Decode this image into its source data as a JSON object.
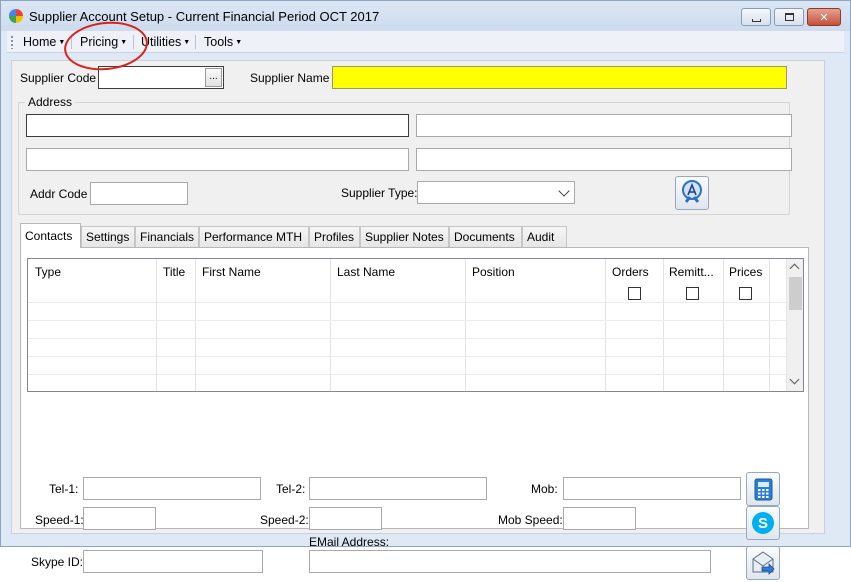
{
  "window": {
    "title": "Supplier Account Setup - Current Financial Period OCT 2017"
  },
  "menubar": {
    "items": [
      {
        "label": "Home"
      },
      {
        "label": "Pricing"
      },
      {
        "label": "Utilities"
      },
      {
        "label": "Tools"
      }
    ]
  },
  "header": {
    "supplier_code_label": "Supplier Code",
    "supplier_code_value": "",
    "lookup_button": "...",
    "supplier_name_label": "Supplier Name",
    "supplier_name_value": "",
    "supplier_name_bg": "#ffff00"
  },
  "address": {
    "group_label": "Address",
    "line1": "",
    "line2": "",
    "line3": "",
    "line4": "",
    "addr_code_label": "Addr Code",
    "addr_code_value": "",
    "supplier_type_label": "Supplier Type:",
    "supplier_type_value": "",
    "search_icon": "search-icon"
  },
  "tabs": [
    {
      "label": "Contacts",
      "active": true
    },
    {
      "label": "Settings"
    },
    {
      "label": "Financials"
    },
    {
      "label": "Performance MTH"
    },
    {
      "label": "Profiles"
    },
    {
      "label": "Supplier Notes"
    },
    {
      "label": "Documents"
    },
    {
      "label": "Audit"
    }
  ],
  "contacts_grid": {
    "columns": [
      "Type",
      "Title",
      "First Name",
      "Last Name",
      "Position",
      "Orders",
      "Remitt...",
      "Prices"
    ],
    "rows": []
  },
  "contact_fields": {
    "tel1_label": "Tel-1:",
    "tel2_label": "Tel-2:",
    "mob_label": "Mob:",
    "speed1_label": "Speed-1:",
    "speed2_label": "Speed-2:",
    "mob_speed_label": "Mob Speed:",
    "skype_label": "Skype ID:",
    "email_label": "EMail Address:",
    "phone_icon": "phone-icon",
    "skype_icon": "skype-icon",
    "email_icon": "send-email-icon"
  },
  "colors": {
    "annotation": "#d9221c",
    "window_bg": "#dfe9f5"
  }
}
